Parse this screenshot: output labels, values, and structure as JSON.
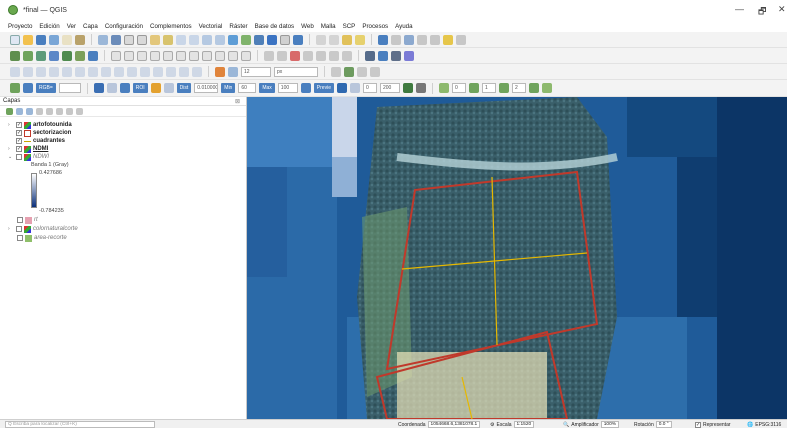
{
  "window": {
    "title": "*final — QGIS",
    "minimize_symbol": "—",
    "restore_symbol": "🗗",
    "close_symbol": "✕"
  },
  "menu": [
    "Proyecto",
    "Edición",
    "Ver",
    "Capa",
    "Configuración",
    "Complementos",
    "Vectorial",
    "Ráster",
    "Base de datos",
    "Web",
    "Malla",
    "SCP",
    "Procesos",
    "Ayuda"
  ],
  "scp_toolbar": {
    "rgb_field": "RGB=",
    "roi_label": "ROI",
    "dist_label": "Dist",
    "dist_value": "0.010000",
    "min_label": "Min",
    "min_value": "60",
    "max_label": "Max",
    "max_value": "100",
    "preview_label": "Previe",
    "field_1": "0",
    "field_2": "200",
    "field_3": "0",
    "field_4": "1",
    "field_5": "2"
  },
  "attr_toolbar": {
    "field_12": "12",
    "field_px": "px"
  },
  "layers_panel": {
    "title": "Capas",
    "close_symbol": "⊠",
    "layers": [
      {
        "name": "artofotounida",
        "bold": true,
        "checked": true,
        "expander": "›",
        "icon": "raster-icon"
      },
      {
        "name": "sectorizacion",
        "bold": true,
        "checked": true,
        "expander": "",
        "icon": "polygon-icon"
      },
      {
        "name": "cuadrantes",
        "bold": true,
        "checked": true,
        "expander": "",
        "icon": "line-icon"
      },
      {
        "name": "NDMI",
        "bold": true,
        "underline": true,
        "checked": true,
        "expander": "›",
        "icon": "raster-icon"
      },
      {
        "name": "NDWI",
        "italic": true,
        "checked": false,
        "expander": "⌄",
        "icon": "raster-icon"
      },
      {
        "name": "rt",
        "italic": true,
        "checked": false,
        "expander": "",
        "icon": "polygon-icon"
      },
      {
        "name": "colornaturalcorte",
        "italic": true,
        "checked": false,
        "expander": "›",
        "icon": "raster-icon"
      },
      {
        "name": "area-recorte",
        "italic": true,
        "checked": false,
        "expander": "",
        "icon": "polygon-icon"
      }
    ],
    "legend": {
      "band": "Banda 1 (Gray)",
      "max": "0.427686",
      "min": "-0.784235"
    }
  },
  "statusbar": {
    "search_placeholder": "Q  Escriba para localizar (Ctrl+K)",
    "coord_label": "Coordenada",
    "coord_value": "1054668.6,1381078.1",
    "scale_label": "Escala",
    "scale_value": "1:1520",
    "magnifier_label": "Amplificador",
    "magnifier_value": "100%",
    "rotation_label": "Rotación",
    "rotation_value": "0.0 °",
    "render_label": "Representar",
    "crs": "EPSG:3116"
  },
  "colors": {
    "accent": "#4a7fbf",
    "grid_red": "#c0392b",
    "grid_yellow": "#e6b800",
    "ndmi_deep": "#0b3d8c"
  }
}
